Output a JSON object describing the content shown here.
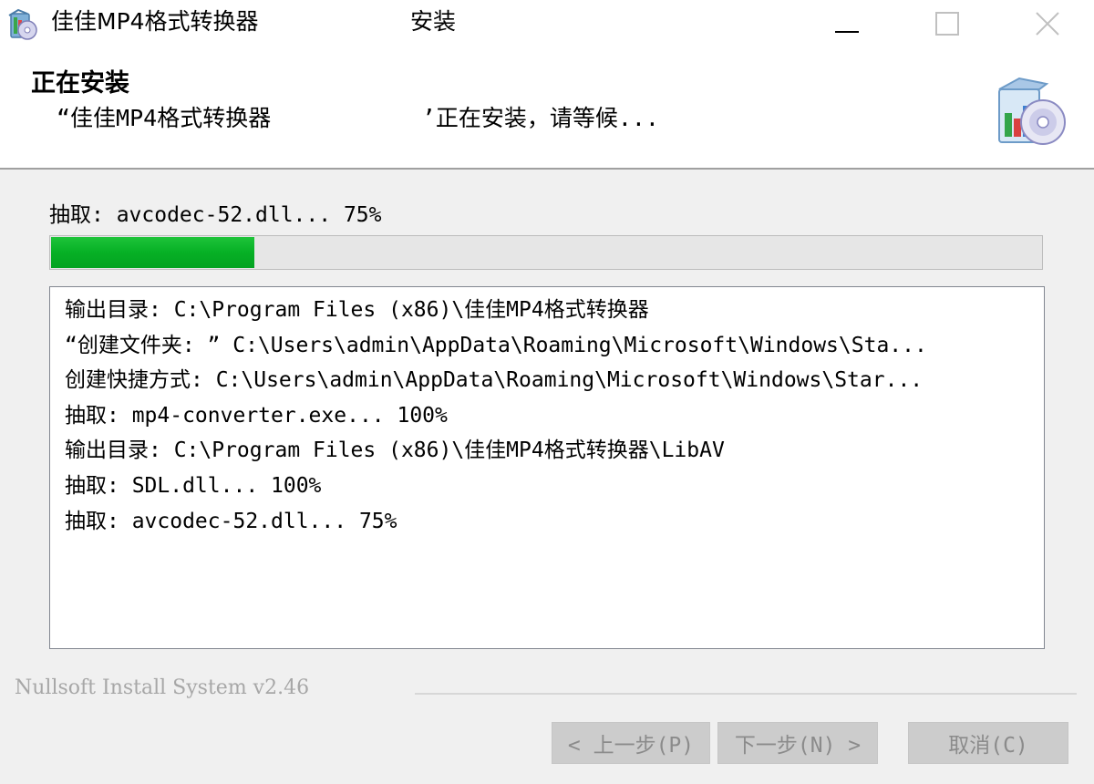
{
  "window": {
    "title": "佳佳MP4格式转换器",
    "title_suffix": "安装",
    "controls": {
      "minimize": "minimize-icon",
      "maximize": "maximize-icon",
      "close": "close-icon"
    }
  },
  "header": {
    "title": "正在安装",
    "subtitle": "“佳佳MP4格式转换器           ’正在安装，请等候...",
    "icon": "installer-cd-icon"
  },
  "progress": {
    "status": "抽取: avcodec-52.dll... 75%",
    "fraction": 0.205,
    "color": "#06b025"
  },
  "log": {
    "lines": [
      "输出目录: C:\\Program Files (x86)\\佳佳MP4格式转换器",
      "“创建文件夹: ” C:\\Users\\admin\\AppData\\Roaming\\Microsoft\\Windows\\Sta...",
      "创建快捷方式: C:\\Users\\admin\\AppData\\Roaming\\Microsoft\\Windows\\Star...",
      "抽取: mp4-converter.exe... 100%",
      "输出目录: C:\\Program Files (x86)\\佳佳MP4格式转换器\\LibAV",
      "抽取: SDL.dll... 100%",
      "抽取: avcodec-52.dll... 75%"
    ]
  },
  "footer": {
    "brand": "Nullsoft Install System v2.46",
    "buttons": {
      "back": "< 上一步(P)",
      "next": "下一步(N) >",
      "cancel": "取消(C)"
    }
  }
}
